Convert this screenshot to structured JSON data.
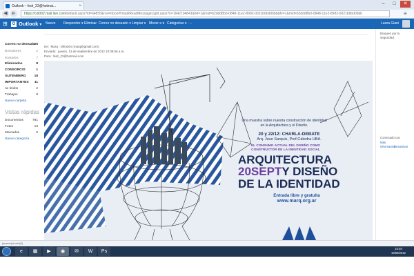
{
  "browser": {
    "tab_title": "Outlook – fedr_23@hotmai...",
    "url_host": "https://col002.mail.live.com",
    "url_path": "/default.aspx?id=64855&rru=inbox#!/mail/ReadMessageLight.aspx?n=1642104841&fid=1&mid=b2ddd8b0-0848-11e2-8982-0021b6bd06bb&fv=1&mid=b2ddd8b0-0848-11e2-8982-0021b6bd06bb",
    "back_glyph": "◀",
    "forward_glyph": "▶",
    "menu_glyph": "≡",
    "min_glyph": "–",
    "max_glyph": "□",
    "close_glyph": "✕",
    "tab_close_glyph": "×"
  },
  "outlook": {
    "grid_glyph": "⊞",
    "logo_letter": "O",
    "logo_text": "Outlook",
    "logo_chevron": "▾",
    "toolbar": [
      {
        "label": "Nuevo"
      },
      {
        "label": "Responder ▾"
      },
      {
        "label": "Eliminar"
      },
      {
        "label": "Correo no deseado ▾"
      },
      {
        "label": "Limpiar ▾"
      },
      {
        "label": "Mover a ▾"
      },
      {
        "label": "Categorías ▾"
      },
      {
        "label": "···"
      }
    ],
    "user_name": "Laura Giani"
  },
  "sidebar": {
    "folders": [
      {
        "label": "Correo no deseado",
        "count": "25"
      },
      {
        "label": "Borradores",
        "count": "2"
      },
      {
        "label": "Enviados",
        "count": "7"
      },
      {
        "label": "Eliminados",
        "count": "8"
      },
      {
        "label": "CONSORCIO",
        "count": "1"
      },
      {
        "label": "GUTENBERG",
        "count": "18"
      },
      {
        "label": "IMPORTANTES",
        "count": "11"
      },
      {
        "label": "no leidos",
        "count": "2"
      },
      {
        "label": "Trabajos",
        "count": "8"
      },
      {
        "label": "Nueva carpeta",
        "count": ""
      }
    ],
    "views_title": "Vistas rápidas",
    "views": [
      {
        "label": "Documentos",
        "count": "781"
      },
      {
        "label": "Fotos",
        "count": "13"
      },
      {
        "label": "Marcados",
        "count": "6"
      },
      {
        "label": "Nueva categoría",
        "count": ""
      }
    ]
  },
  "message": {
    "from_label": "De:",
    "from_value": "Marq - Difusión (marq@gmail.com)",
    "sent_label": "Enviado:",
    "sent_value": "jueves, 13 de septiembre de 2012 10:08:56 a.m.",
    "to_label": "Para:",
    "to_value": "fedr_23@hotmail.com"
  },
  "poster": {
    "intro": "Una muestra sobre nuestra construcción de identidad en la Arquitectura y el Diseño.",
    "date_line": "20 y 22/12: CHARLA-DEBATE",
    "speakers": "Arq. Jose Sarquis, Prof.Cátedra UBA.",
    "theme_line1": "EL CONSUMO ACTUAL DEL DISEÑO COMO",
    "theme_line2": "CONSTRUCTOR DE LA IDENTIDAD SOCIAL",
    "title1": "ARQUITECTURA",
    "title2_date": "20SEPT",
    "title2_rest": "Y DISEÑO",
    "title3": "DE LA IDENTIDAD",
    "entry": "Entrada libre y gratuita",
    "website": "www.marq.org.ar",
    "logo_alt": "MARQ",
    "colors": {
      "title_dark": "#1b2a55",
      "title_accent": "#6b3fa0",
      "blue": "#1f4f9a",
      "bg": "#e8eef4"
    }
  },
  "rightpane": {
    "text": "bloqueó por tu seguridad.",
    "connected": "Conectado con",
    "more": "Más",
    "connect": "información",
    "disable": "Desactivar"
  },
  "status": {
    "text": "javascript:void(0)"
  },
  "taskbar": {
    "apps": [
      {
        "glyph": "e"
      },
      {
        "glyph": "▦"
      },
      {
        "glyph": "▶"
      },
      {
        "glyph": "◉"
      },
      {
        "glyph": "✉"
      },
      {
        "glyph": "W"
      },
      {
        "glyph": "Ps"
      }
    ],
    "time": "10:49",
    "date": "19/09/2012"
  }
}
